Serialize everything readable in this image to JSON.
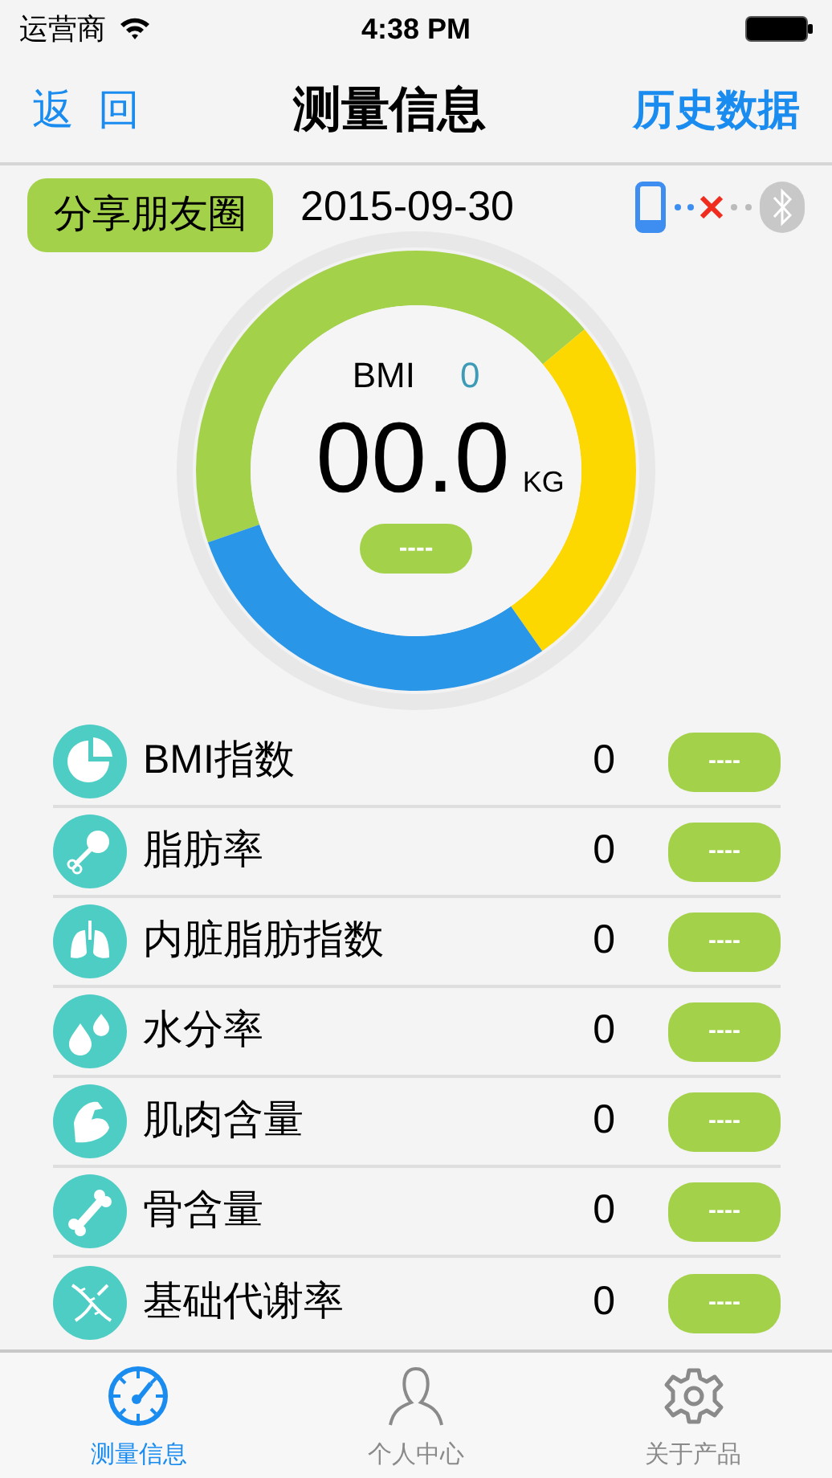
{
  "status_bar": {
    "carrier": "运营商",
    "time": "4:38 PM"
  },
  "nav": {
    "back": "返 回",
    "title": "测量信息",
    "history": "历史数据"
  },
  "share_button": "分享朋友圈",
  "date": "2015-09-30",
  "device_connected": false,
  "gauge": {
    "label": "BMI",
    "bmi_value": "0",
    "weight": "00.0",
    "unit": "KG",
    "status": "----"
  },
  "metrics": [
    {
      "name": "BMI指数",
      "value": "0",
      "status": "----"
    },
    {
      "name": "脂肪率",
      "value": "0",
      "status": "----"
    },
    {
      "name": "内脏脂肪指数",
      "value": "0",
      "status": "----"
    },
    {
      "name": "水分率",
      "value": "0",
      "status": "----"
    },
    {
      "name": "肌肉含量",
      "value": "0",
      "status": "----"
    },
    {
      "name": "骨含量",
      "value": "0",
      "status": "----"
    },
    {
      "name": "基础代谢率",
      "value": "0",
      "status": "----"
    }
  ],
  "tabs": [
    {
      "label": "测量信息",
      "selected": true
    },
    {
      "label": "个人中心",
      "selected": false
    },
    {
      "label": "关于产品",
      "selected": false
    }
  ]
}
